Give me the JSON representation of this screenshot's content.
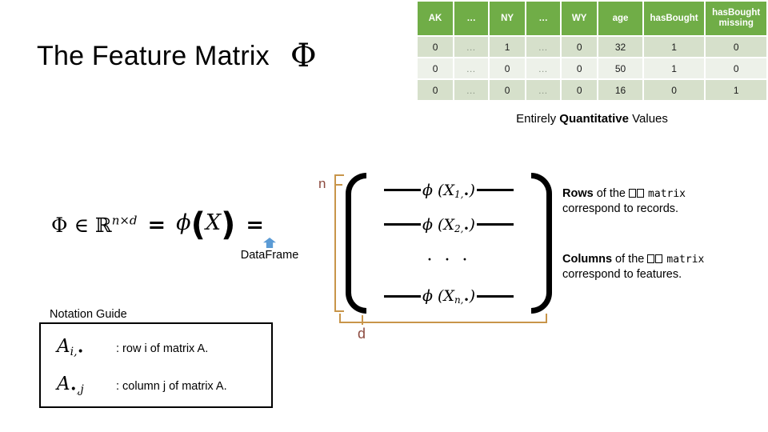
{
  "slide": {
    "title": "The Feature Matrix",
    "title_symbol": "Φ"
  },
  "feature_table": {
    "headers": [
      "AK",
      "…",
      "NY",
      "…",
      "WY",
      "age",
      "hasBought",
      "hasBought missing"
    ],
    "rows": [
      [
        "0",
        "…",
        "1",
        "…",
        "0",
        "32",
        "1",
        "0"
      ],
      [
        "0",
        "…",
        "0",
        "…",
        "0",
        "50",
        "1",
        "0"
      ],
      [
        "0",
        "…",
        "0",
        "…",
        "0",
        "16",
        "0",
        "1"
      ]
    ],
    "header_bg": "#70ad47",
    "row_band_dark": "#d6e0cb",
    "row_band_light": "#edf1e9"
  },
  "caption": {
    "prefix": "Entirely ",
    "emphasis": "Quantitative",
    "suffix": " Values"
  },
  "equation": {
    "phi": "Φ",
    "member_of": "∈",
    "reals": "ℝ",
    "exponent": "n×d",
    "equals": "=",
    "phi_lower": "ϕ",
    "paren_open": "(",
    "x_variable": "X",
    "paren_close": ")",
    "equals_two": "=",
    "dataframe_label": "DataFrame",
    "arrow_color": "#5b9bd5"
  },
  "matrix": {
    "rows": [
      {
        "expr": "ϕ (X",
        "sub": "1,•",
        "close": ")"
      },
      {
        "expr": "ϕ (X",
        "sub": "2,•",
        "close": ")"
      },
      {
        "expr": "ϕ (X",
        "sub": "n,•",
        "close": ")"
      }
    ],
    "ellipsis": "· · ·",
    "brace_n_label": "n",
    "brace_d_label": "d",
    "brace_color": "#c8954a",
    "brace_label_color": "#8c4a3f"
  },
  "notes": {
    "rows": {
      "emphasis": "Rows",
      "mid": " of the ",
      "mono": "matrix",
      "tail": "correspond to records."
    },
    "columns": {
      "emphasis": "Columns",
      "mid": " of the ",
      "mono": "matrix",
      "tail": "correspond to features."
    }
  },
  "notation_guide": {
    "label": "Notation Guide",
    "entries": [
      {
        "symbol": "A",
        "sub": "i,•",
        "description": ": row i of matrix A."
      },
      {
        "symbol": "A",
        "sub": "•,j",
        "description": ": column j of matrix A."
      }
    ]
  }
}
